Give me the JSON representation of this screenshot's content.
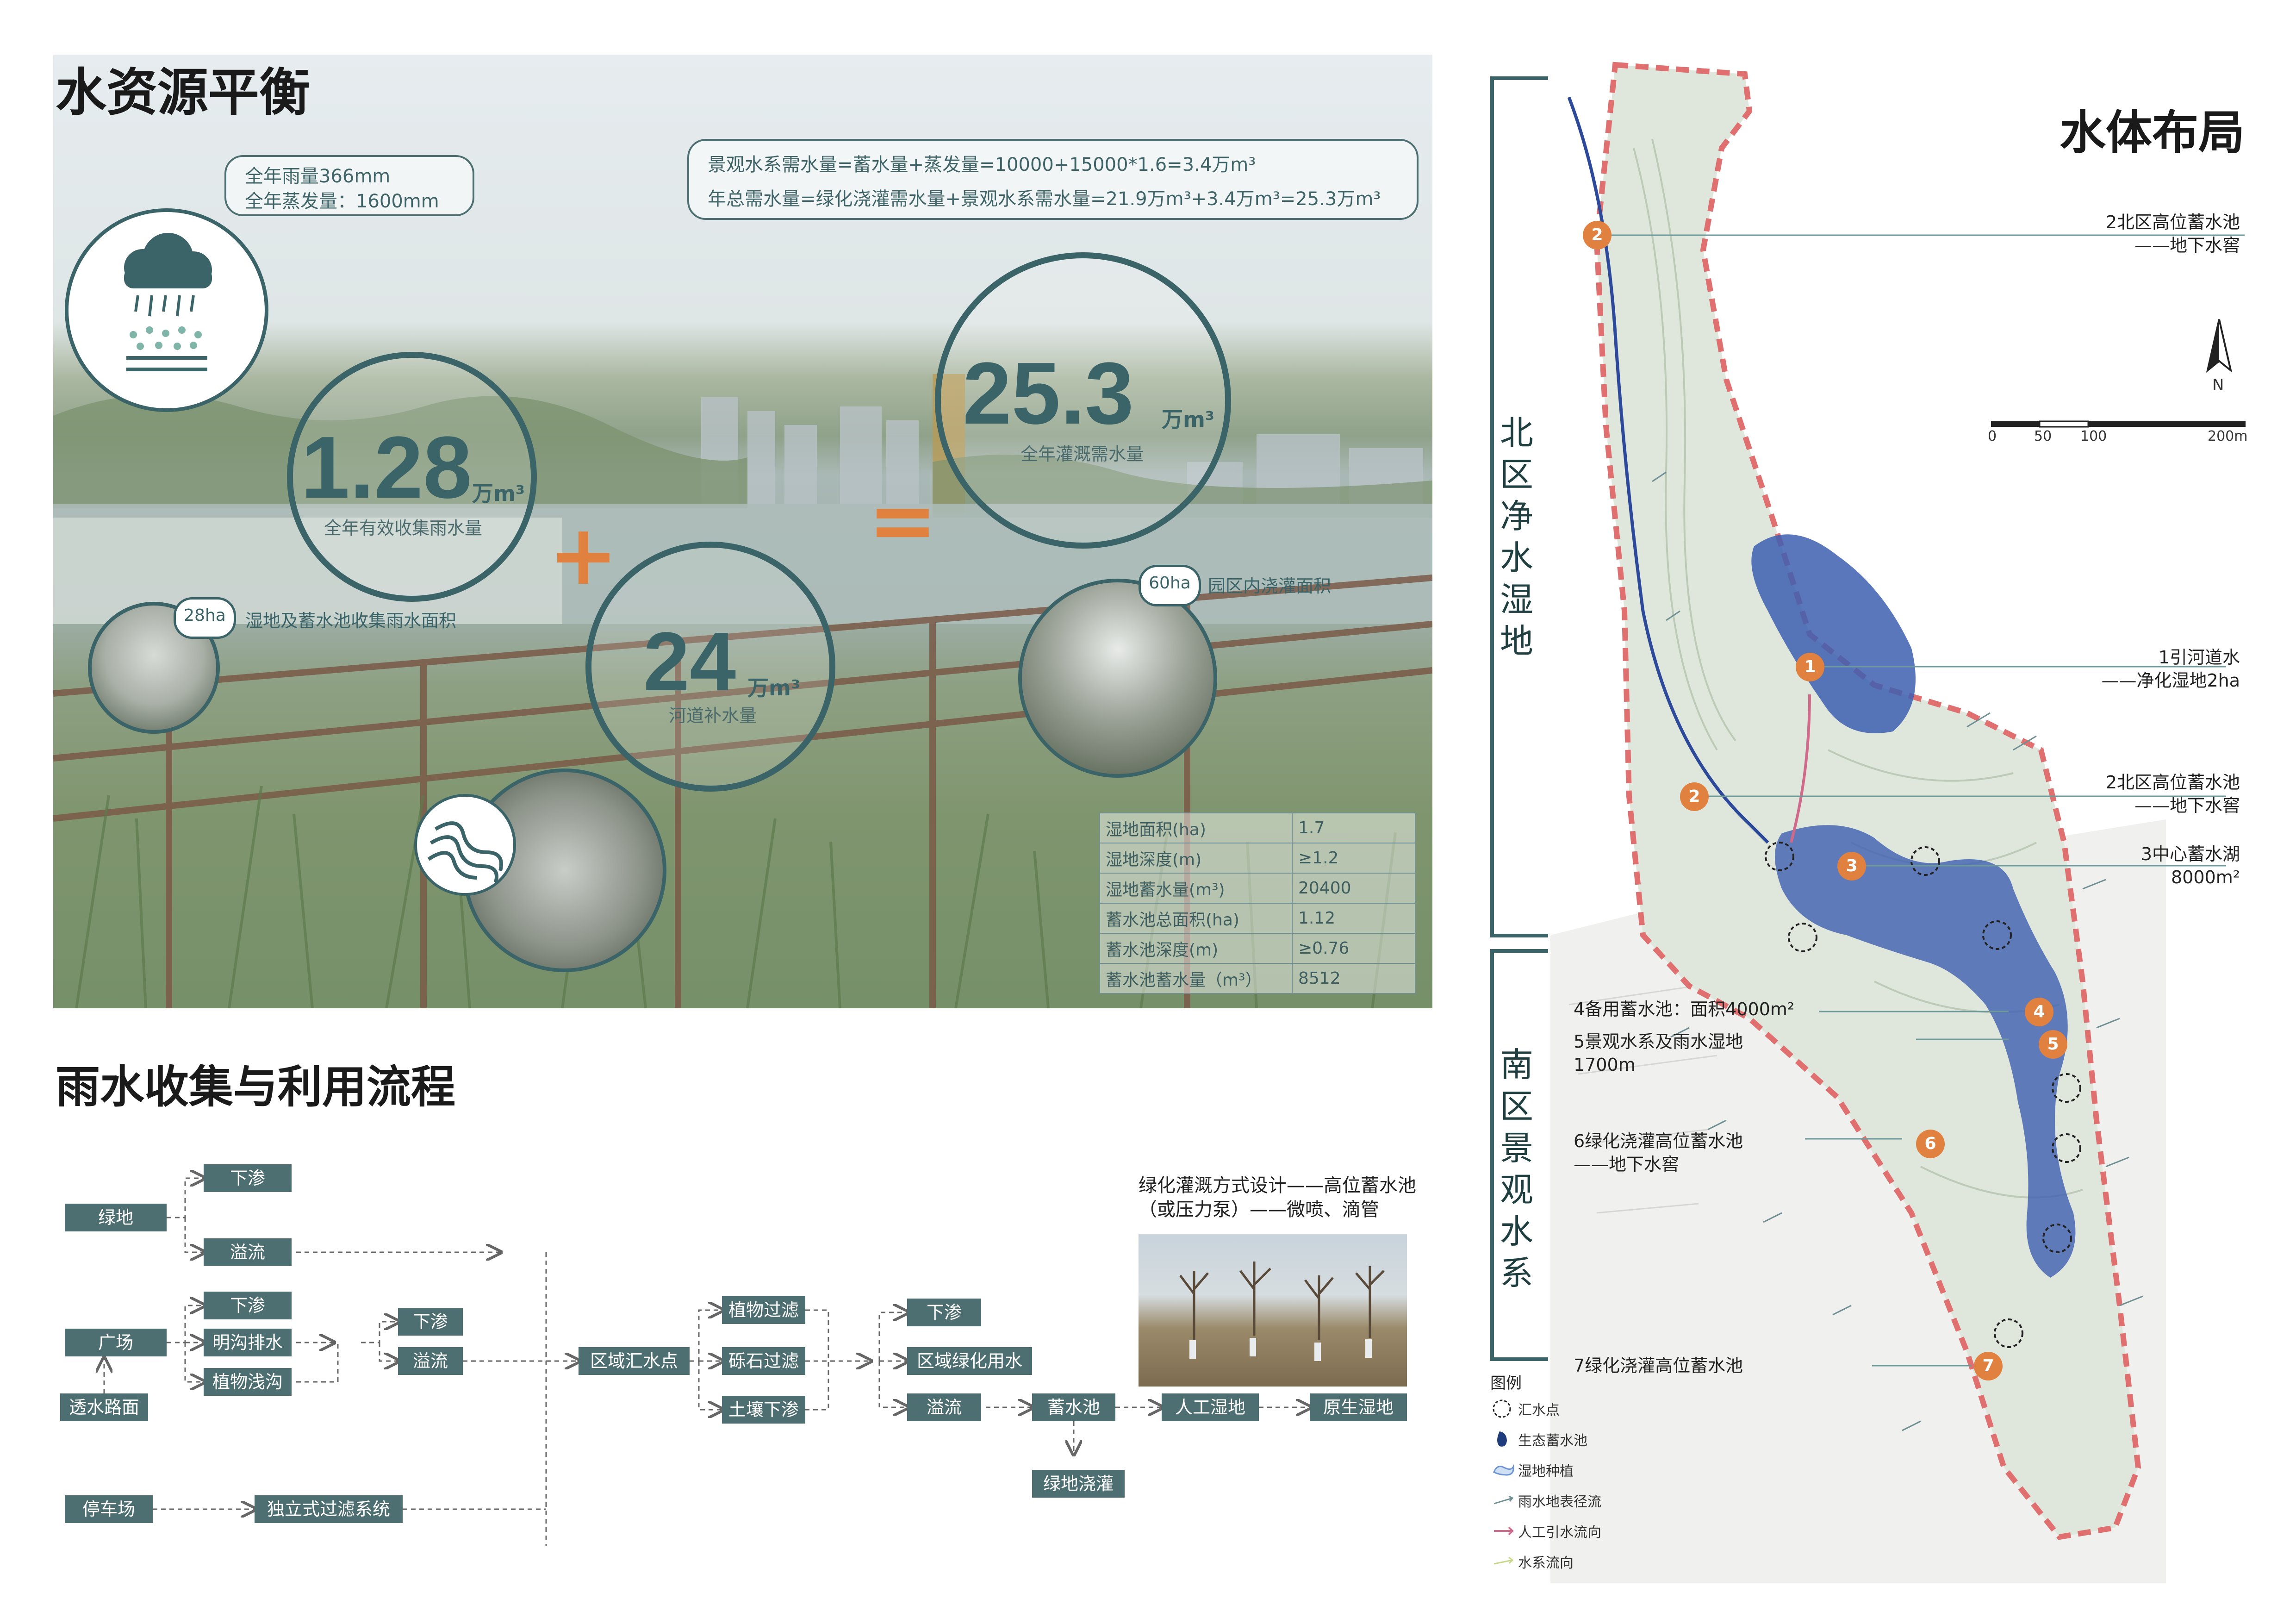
{
  "section1": {
    "title": "水资源平衡",
    "rain_note": [
      "全年雨量366mm",
      "全年蒸发量：1600mm"
    ],
    "formula_note": [
      "景观水系需水量=蓄水量+蒸发量=10000+15000*1.6=3.4万m³",
      "年总需水量=绿化浇灌需水量+景观水系需水量=21.9万m³+3.4万m³=25.3万m³"
    ],
    "collect": {
      "value": "1.28",
      "unit": "万m³",
      "label": "全年有效收集雨水量"
    },
    "river": {
      "value": "24",
      "unit": "万m³",
      "label": "河道补水量"
    },
    "total": {
      "value": "25.3",
      "unit": "万m³",
      "label": "全年灌溉需水量"
    },
    "plus": "+",
    "equals": "=",
    "wetland_area": {
      "value": "28ha",
      "label": "湿地及蓄水池收集雨水面积"
    },
    "irrigation_area": {
      "value": "60ha",
      "label": "园区内浇灌面积"
    },
    "stats": [
      {
        "k": "湿地面积(ha)",
        "v": "1.7"
      },
      {
        "k": "湿地深度(m)",
        "v": "≥1.2"
      },
      {
        "k": "湿地蓄水量(m³)",
        "v": "20400"
      },
      {
        "k": "蓄水池总面积(ha)",
        "v": "1.12"
      },
      {
        "k": "蓄水池深度(m)",
        "v": "≥0.76"
      },
      {
        "k": "蓄水池蓄水量（m³）",
        "v": "8512"
      }
    ]
  },
  "section2": {
    "title": "雨水收集与利用流程",
    "nodes": {
      "green": "绿地",
      "square": "广场",
      "permeable": "透水路面",
      "parking": "停车场",
      "infiltrate1": "下渗",
      "overflow1": "溢流",
      "infiltrate2": "下渗",
      "ditch": "明沟排水",
      "swale": "植物浅沟",
      "infiltrate3": "下渗",
      "overflow3": "溢流",
      "filter_sys": "独立式过滤系统",
      "collect_point": "区域汇水点",
      "plant_filter": "植物过滤",
      "gravel_filter": "砾石过滤",
      "soil_infiltrate": "土壤下渗",
      "infiltrate4": "下渗",
      "regional_green": "区域绿化用水",
      "overflow4": "溢流",
      "pond": "蓄水池",
      "artificial": "人工湿地",
      "natural": "原生湿地",
      "green_irrigate": "绿地浇灌"
    },
    "irrigation_note": "绿化灌溉方式设计——高位蓄水池（或压力泵）——微喷、滴管"
  },
  "section3": {
    "title": "水体布局",
    "north_label": "北区净水湿地",
    "south_label": "南区景观水系",
    "scale": {
      "ticks": [
        "0",
        "50",
        "100",
        "200m"
      ]
    },
    "north_symbol": "N",
    "labels_right": [
      {
        "num": "2",
        "text": [
          "2北区高位蓄水池",
          "——地下水窖"
        ]
      },
      {
        "num": "1",
        "text": [
          "1引河道水",
          "——净化湿地2ha"
        ]
      },
      {
        "num": "2",
        "text": [
          "2北区高位蓄水池",
          "——地下水窖"
        ]
      },
      {
        "num": "3",
        "text": [
          "3中心蓄水湖",
          "8000m²"
        ]
      }
    ],
    "labels_left": [
      {
        "text": [
          "4备用蓄水池：面积4000m²"
        ]
      },
      {
        "text": [
          "5景观水系及雨水湿地",
          "1700m"
        ]
      },
      {
        "text": [
          "6绿化浇灌高位蓄水池",
          "——地下水窖"
        ]
      },
      {
        "text": [
          "7绿化浇灌高位蓄水池"
        ]
      }
    ],
    "markers": [
      "2",
      "1",
      "2",
      "3",
      "4",
      "5",
      "6",
      "7"
    ],
    "legend": {
      "title": "图例",
      "items": [
        "汇水点",
        "生态蓄水池",
        "湿地种植",
        "雨水地表径流",
        "人工引水流向",
        "水系流向"
      ]
    },
    "colors": {
      "accent": "#e0813f",
      "teal": "#4d6f72",
      "water": "#3d5fb0",
      "boundary": "#e07070"
    }
  }
}
